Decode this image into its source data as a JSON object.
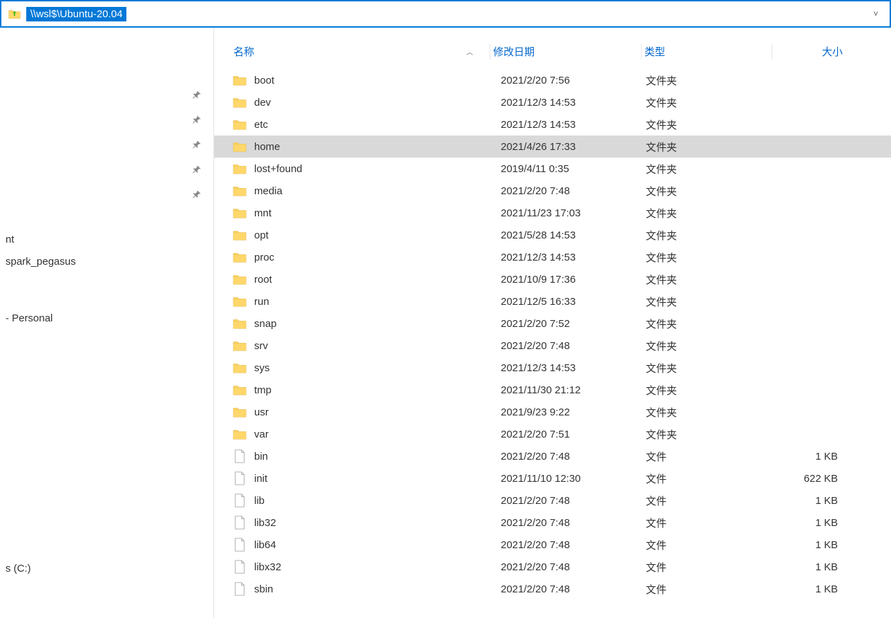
{
  "addressbar": {
    "path": "\\\\wsl$\\Ubuntu-20.04"
  },
  "columns": {
    "name": "名称",
    "date": "修改日期",
    "type": "类型",
    "size": "大小"
  },
  "sidebar": {
    "item0": "nt",
    "item1": "spark_pegasus",
    "item2": "- Personal",
    "item3": "s (C:)"
  },
  "type_labels": {
    "folder": "文件夹",
    "file": "文件"
  },
  "selected_index": 3,
  "files": [
    {
      "name": "boot",
      "date": "2021/2/20 7:56",
      "type": "文件夹",
      "size": "",
      "kind": "folder"
    },
    {
      "name": "dev",
      "date": "2021/12/3 14:53",
      "type": "文件夹",
      "size": "",
      "kind": "folder"
    },
    {
      "name": "etc",
      "date": "2021/12/3 14:53",
      "type": "文件夹",
      "size": "",
      "kind": "folder"
    },
    {
      "name": "home",
      "date": "2021/4/26 17:33",
      "type": "文件夹",
      "size": "",
      "kind": "folder"
    },
    {
      "name": "lost+found",
      "date": "2019/4/11 0:35",
      "type": "文件夹",
      "size": "",
      "kind": "folder"
    },
    {
      "name": "media",
      "date": "2021/2/20 7:48",
      "type": "文件夹",
      "size": "",
      "kind": "folder"
    },
    {
      "name": "mnt",
      "date": "2021/11/23 17:03",
      "type": "文件夹",
      "size": "",
      "kind": "folder"
    },
    {
      "name": "opt",
      "date": "2021/5/28 14:53",
      "type": "文件夹",
      "size": "",
      "kind": "folder"
    },
    {
      "name": "proc",
      "date": "2021/12/3 14:53",
      "type": "文件夹",
      "size": "",
      "kind": "folder"
    },
    {
      "name": "root",
      "date": "2021/10/9 17:36",
      "type": "文件夹",
      "size": "",
      "kind": "folder"
    },
    {
      "name": "run",
      "date": "2021/12/5 16:33",
      "type": "文件夹",
      "size": "",
      "kind": "folder"
    },
    {
      "name": "snap",
      "date": "2021/2/20 7:52",
      "type": "文件夹",
      "size": "",
      "kind": "folder"
    },
    {
      "name": "srv",
      "date": "2021/2/20 7:48",
      "type": "文件夹",
      "size": "",
      "kind": "folder"
    },
    {
      "name": "sys",
      "date": "2021/12/3 14:53",
      "type": "文件夹",
      "size": "",
      "kind": "folder"
    },
    {
      "name": "tmp",
      "date": "2021/11/30 21:12",
      "type": "文件夹",
      "size": "",
      "kind": "folder"
    },
    {
      "name": "usr",
      "date": "2021/9/23 9:22",
      "type": "文件夹",
      "size": "",
      "kind": "folder"
    },
    {
      "name": "var",
      "date": "2021/2/20 7:51",
      "type": "文件夹",
      "size": "",
      "kind": "folder"
    },
    {
      "name": "bin",
      "date": "2021/2/20 7:48",
      "type": "文件",
      "size": "1 KB",
      "kind": "file"
    },
    {
      "name": "init",
      "date": "2021/11/10 12:30",
      "type": "文件",
      "size": "622 KB",
      "kind": "file"
    },
    {
      "name": "lib",
      "date": "2021/2/20 7:48",
      "type": "文件",
      "size": "1 KB",
      "kind": "file"
    },
    {
      "name": "lib32",
      "date": "2021/2/20 7:48",
      "type": "文件",
      "size": "1 KB",
      "kind": "file"
    },
    {
      "name": "lib64",
      "date": "2021/2/20 7:48",
      "type": "文件",
      "size": "1 KB",
      "kind": "file"
    },
    {
      "name": "libx32",
      "date": "2021/2/20 7:48",
      "type": "文件",
      "size": "1 KB",
      "kind": "file"
    },
    {
      "name": "sbin",
      "date": "2021/2/20 7:48",
      "type": "文件",
      "size": "1 KB",
      "kind": "file"
    }
  ]
}
